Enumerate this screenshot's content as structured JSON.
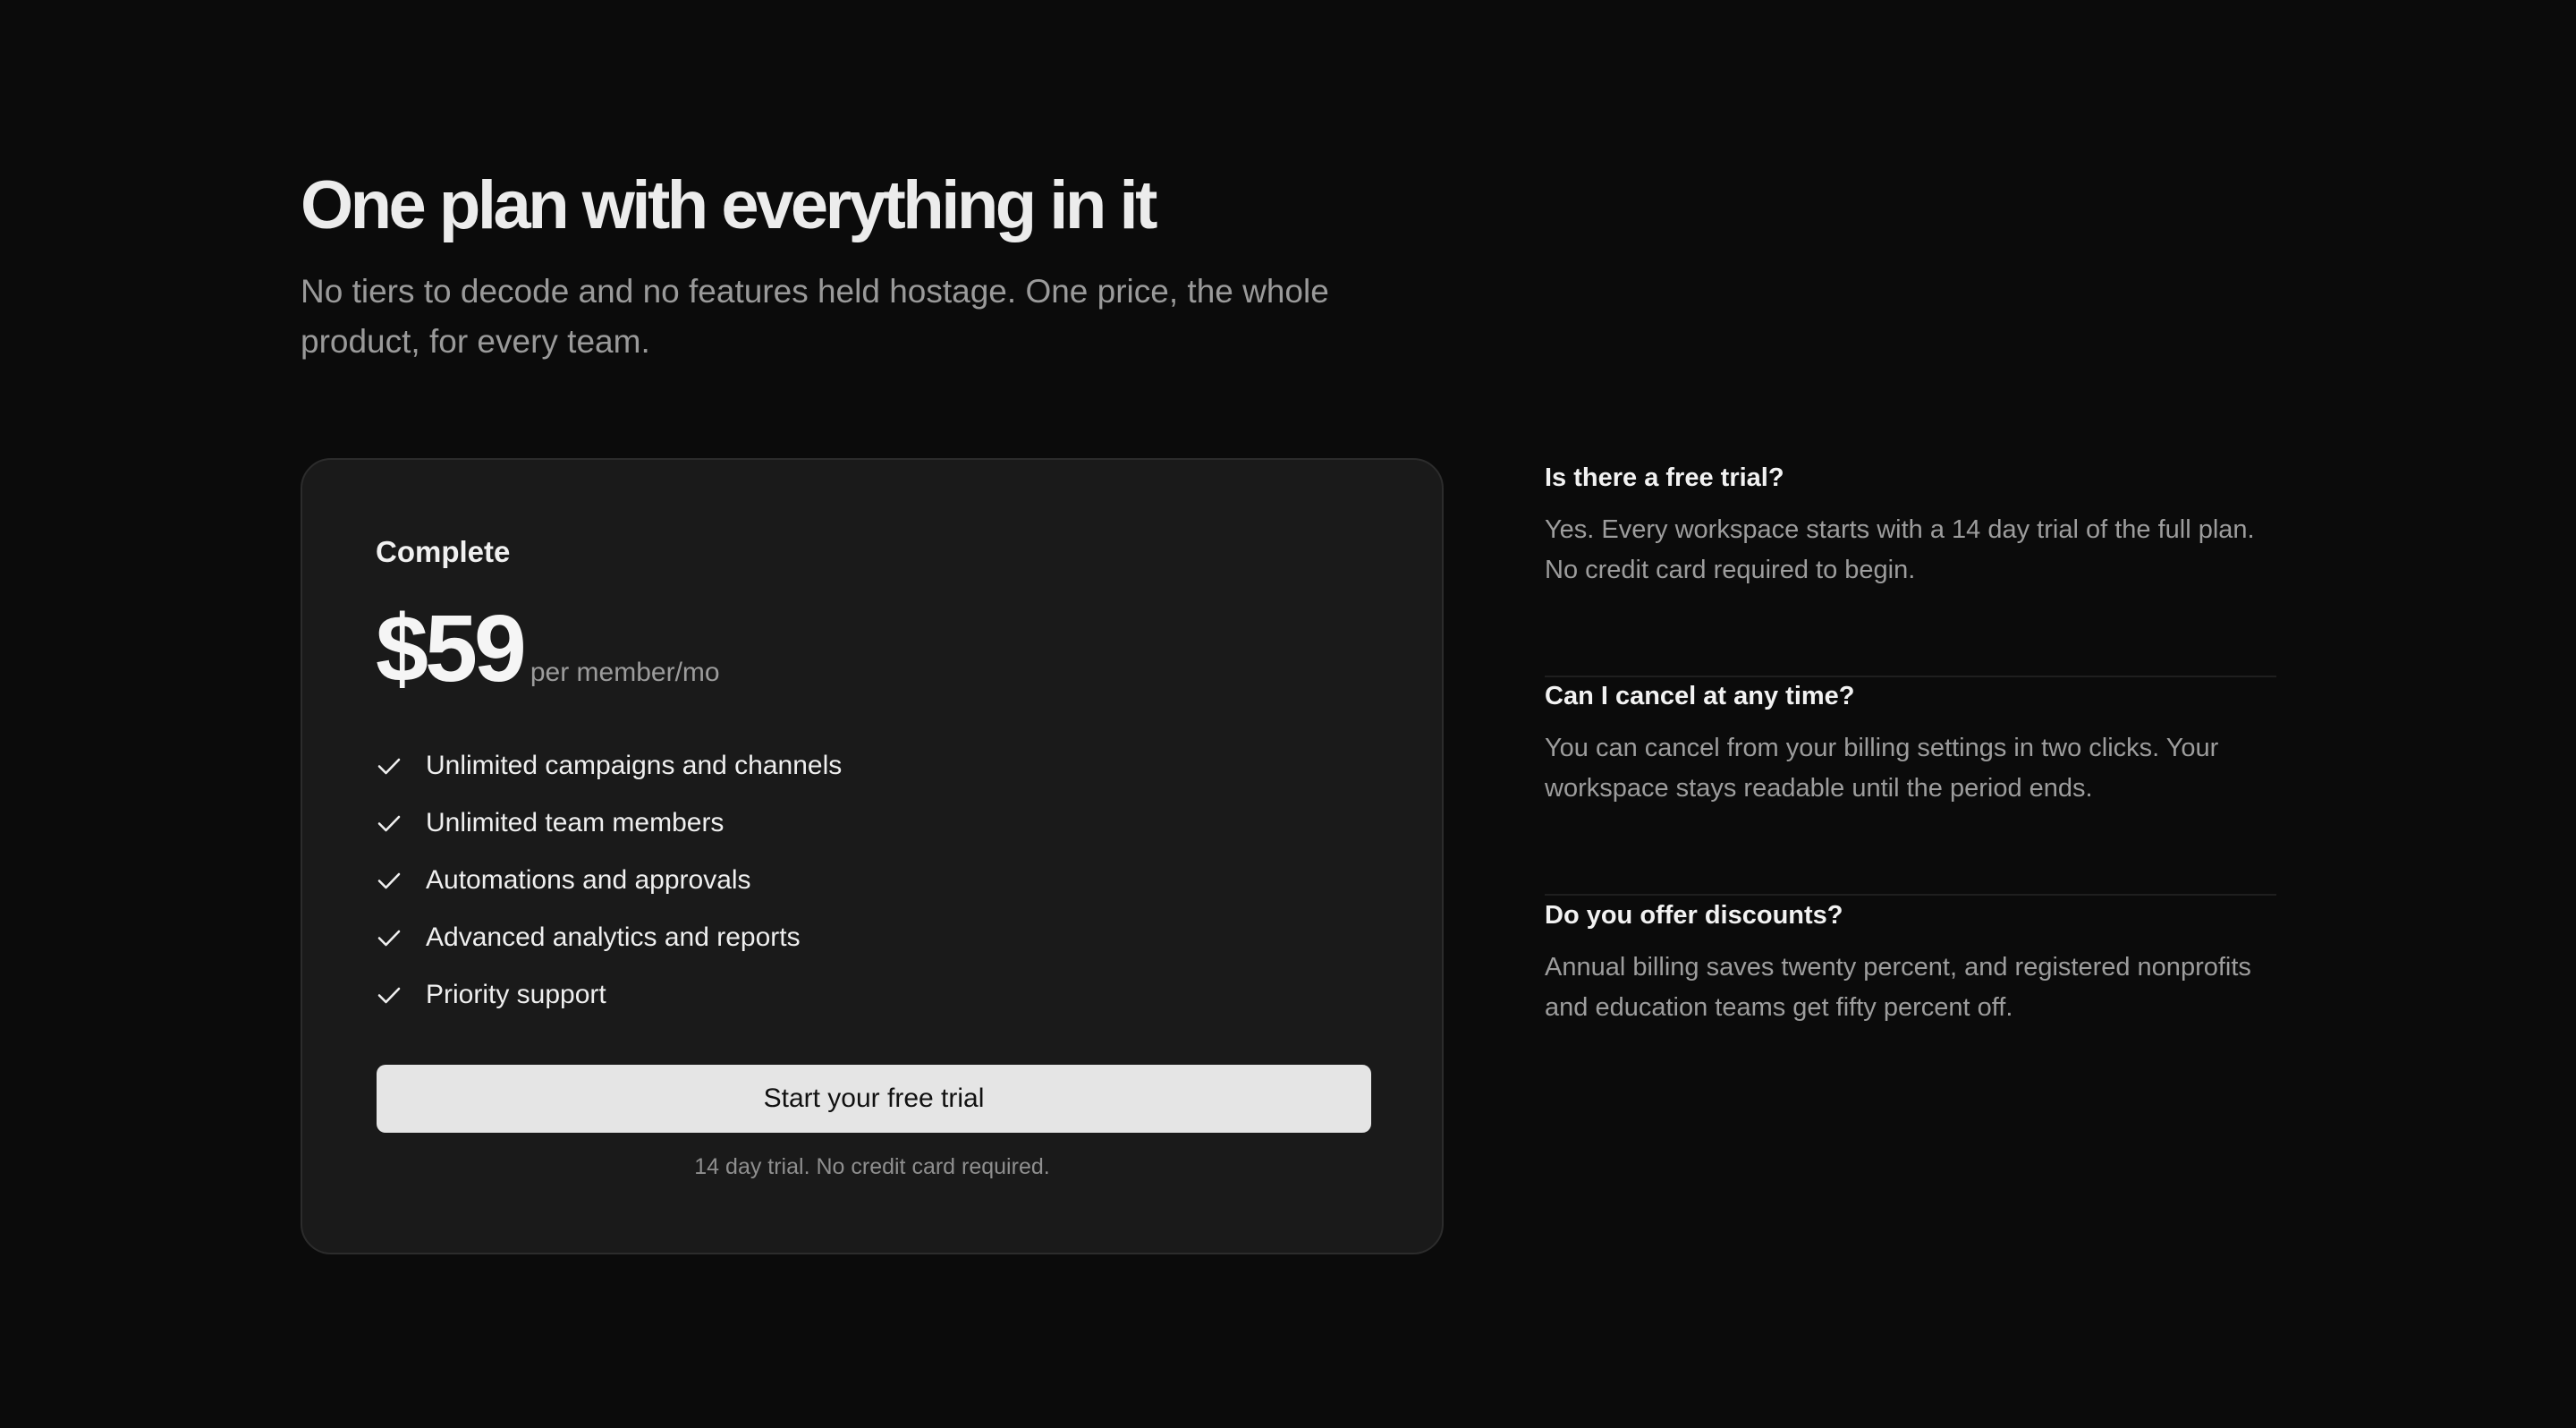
{
  "header": {
    "title": "One plan with everything in it",
    "subtitle": "No tiers to decode and no features held hostage. One price, the whole product, for every team."
  },
  "plan": {
    "name": "Complete",
    "price": "$59",
    "price_unit": "per member/mo",
    "features": [
      "Unlimited campaigns and channels",
      "Unlimited team members",
      "Automations and approvals",
      "Advanced analytics and reports",
      "Priority support"
    ],
    "cta_label": "Start your free trial",
    "cta_note": "14 day trial. No credit card required."
  },
  "faq": [
    {
      "question": "Is there a free trial?",
      "answer": "Yes. Every workspace starts with a 14 day trial of the full plan. No credit card required to begin."
    },
    {
      "question": "Can I cancel at any time?",
      "answer": "You can cancel from your billing settings in two clicks. Your workspace stays readable until the period ends."
    },
    {
      "question": "Do you offer discounts?",
      "answer": "Annual billing saves twenty percent, and registered nonprofits and education teams get fifty percent off."
    }
  ],
  "icons": {
    "feature_bullet": "check-icon"
  },
  "colors": {
    "background": "#0b0b0b",
    "card": "#1a1a1a",
    "button": "#e5e5e5"
  }
}
